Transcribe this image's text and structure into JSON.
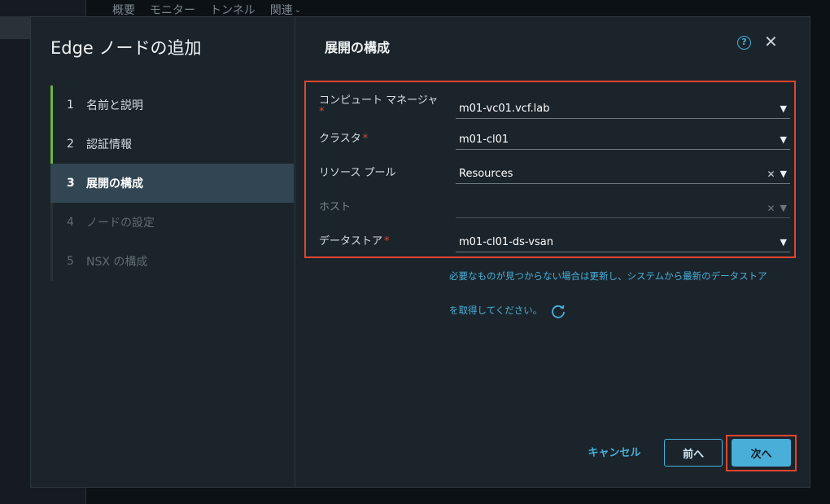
{
  "background": {
    "tabs": [
      "概要",
      "モニター",
      "トンネル",
      "関連"
    ]
  },
  "wizard": {
    "title": "Edge ノードの追加",
    "steps": [
      {
        "num": "1",
        "label": "名前と説明",
        "state": "done"
      },
      {
        "num": "2",
        "label": "認証情報",
        "state": "done"
      },
      {
        "num": "3",
        "label": "展開の構成",
        "state": "active"
      },
      {
        "num": "4",
        "label": "ノードの設定",
        "state": "disabled"
      },
      {
        "num": "5",
        "label": "NSX の構成",
        "state": "disabled"
      }
    ]
  },
  "content": {
    "title": "展開の構成",
    "help_icon": "?",
    "close_icon": "✕"
  },
  "form": {
    "compute_manager": {
      "label": "コンピュート マネージャ",
      "required": "*",
      "value": "m01-vc01.vcf.lab"
    },
    "cluster": {
      "label": "クラスタ",
      "required": "*",
      "value": "m01-cl01"
    },
    "resource_pool": {
      "label": "リソース プール",
      "value": "Resources"
    },
    "host": {
      "label": "ホスト",
      "value": ""
    },
    "datastore": {
      "label": "データストア",
      "required": "*",
      "value": "m01-cl01-ds-vsan"
    }
  },
  "hint": {
    "line1": "必要なものが見つからない場合は更新し、システムから最新のデータストア",
    "line2": "を取得してください。"
  },
  "footer": {
    "cancel_label": "キャンセル",
    "back_label": "前へ",
    "next_label": "次へ"
  },
  "colors": {
    "accent": "#49afd9",
    "highlight": "#e0452f",
    "step_done": "#6fb33f"
  }
}
